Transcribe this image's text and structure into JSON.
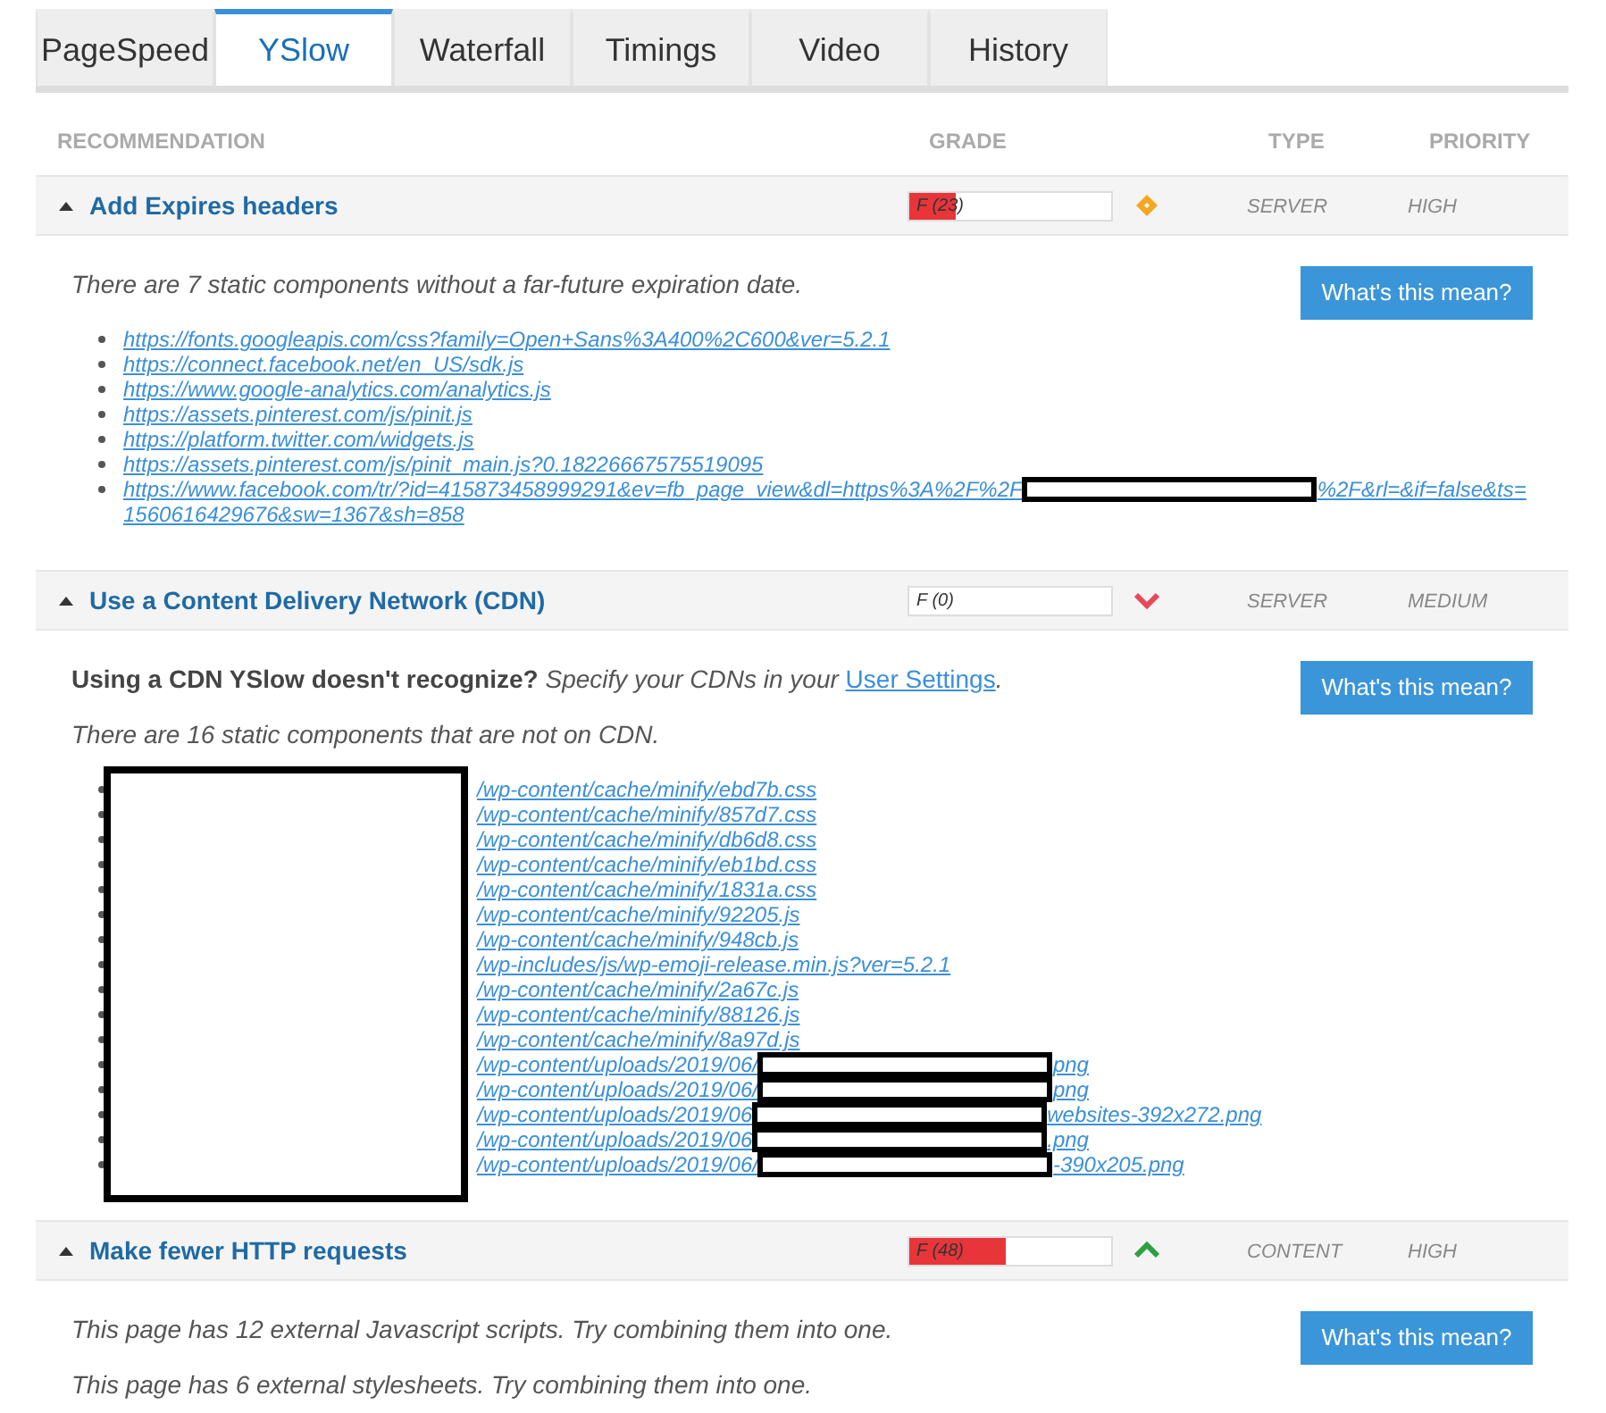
{
  "tabs": [
    {
      "label": "PageSpeed",
      "selected": false
    },
    {
      "label": "YSlow",
      "selected": true
    },
    {
      "label": "Waterfall",
      "selected": false
    },
    {
      "label": "Timings",
      "selected": false
    },
    {
      "label": "Video",
      "selected": false
    },
    {
      "label": "History",
      "selected": false
    }
  ],
  "columns": [
    "RECOMMENDATION",
    "GRADE",
    "TYPE",
    "PRIORITY"
  ],
  "rules": [
    {
      "title": "Add Expires headers",
      "expanded": true,
      "grade": "F (23)",
      "level": 0.23,
      "kind": "diamond",
      "type": "SERVER",
      "priority": "HIGH",
      "button": "What's this mean?",
      "paragraphs": [
        "There are 7 static components without a far-future expiration date."
      ],
      "links": [
        {
          "segments": [
            {
              "kind": "text",
              "text": "https://fonts.googleapis.com/css?family=Open+Sans%3A400%2C600&ver=5.2.1"
            }
          ]
        },
        {
          "segments": [
            {
              "kind": "text",
              "text": "https://connect.facebook.net/en_US/sdk.js"
            }
          ]
        },
        {
          "segments": [
            {
              "kind": "text",
              "text": "https://www.google-analytics.com/analytics.js"
            }
          ]
        },
        {
          "segments": [
            {
              "kind": "text",
              "text": "https://assets.pinterest.com/js/pinit.js"
            }
          ]
        },
        {
          "segments": [
            {
              "kind": "text",
              "text": "https://platform.twitter.com/widgets.js"
            }
          ]
        },
        {
          "segments": [
            {
              "kind": "text",
              "text": "https://assets.pinterest.com/js/pinit_main.js?0.18226667575519095"
            }
          ]
        },
        {
          "segments": [
            {
              "kind": "text",
              "text": "https://www.facebook.com/tr/?id=415873458999291&ev=fb_page_view&dl=https%3A%2F%2F"
            },
            {
              "kind": "redacted"
            },
            {
              "kind": "text",
              "text": "%2F&rl=&if=false&ts="
            },
            {
              "kind": "break"
            },
            {
              "kind": "text",
              "text": "1560616429676&sw=1367&sh=858"
            }
          ]
        }
      ]
    },
    {
      "title": "Use a Content Delivery Network (CDN)",
      "expanded": true,
      "grade": "F (0)",
      "level": 0,
      "kind": "down",
      "type": "SERVER",
      "priority": "MEDIUM",
      "button": "What's this mean?",
      "note": {
        "lead": "Using a CDN YSlow doesn't recognize?",
        "text": "Specify your CDNs in your",
        "link": "User Settings",
        "tail": "."
      },
      "paragraphs": [
        "There are 16 static components that are not on CDN."
      ],
      "redacted_prefix": true,
      "links": [
        {
          "segments": [
            {
              "kind": "text",
              "text": "/wp-content/cache/minify/ebd7b.css"
            }
          ]
        },
        {
          "segments": [
            {
              "kind": "text",
              "text": "/wp-content/cache/minify/857d7.css"
            }
          ]
        },
        {
          "segments": [
            {
              "kind": "text",
              "text": "/wp-content/cache/minify/db6d8.css"
            }
          ]
        },
        {
          "segments": [
            {
              "kind": "text",
              "text": "/wp-content/cache/minify/eb1bd.css"
            }
          ]
        },
        {
          "segments": [
            {
              "kind": "text",
              "text": "/wp-content/cache/minify/1831a.css"
            }
          ]
        },
        {
          "segments": [
            {
              "kind": "text",
              "text": "/wp-content/cache/minify/92205.js"
            }
          ]
        },
        {
          "segments": [
            {
              "kind": "text",
              "text": "/wp-content/cache/minify/948cb.js"
            }
          ]
        },
        {
          "segments": [
            {
              "kind": "text",
              "text": "/wp-includes/js/wp-emoji-release.min.js?ver=5.2.1"
            }
          ]
        },
        {
          "segments": [
            {
              "kind": "text",
              "text": "/wp-content/cache/minify/2a67c.js"
            }
          ]
        },
        {
          "segments": [
            {
              "kind": "text",
              "text": "/wp-content/cache/minify/88126.js"
            }
          ]
        },
        {
          "segments": [
            {
              "kind": "text",
              "text": "/wp-content/cache/minify/8a97d.js"
            }
          ]
        },
        {
          "segments": [
            {
              "kind": "text",
              "text": "/wp-content/uploads/2019/06/"
            },
            {
              "kind": "redacted"
            },
            {
              "kind": "text",
              "text": "png"
            }
          ]
        },
        {
          "segments": [
            {
              "kind": "text",
              "text": "/wp-content/uploads/2019/06/"
            },
            {
              "kind": "redacted"
            },
            {
              "kind": "text",
              "text": "png"
            }
          ]
        },
        {
          "segments": [
            {
              "kind": "text",
              "text": "/wp-content/uploads/2019/06"
            },
            {
              "kind": "redacted"
            },
            {
              "kind": "text",
              "text": "websites-392x272.png"
            }
          ]
        },
        {
          "segments": [
            {
              "kind": "text",
              "text": "/wp-content/uploads/2019/06"
            },
            {
              "kind": "redacted"
            },
            {
              "kind": "text",
              "text": ".png"
            }
          ]
        },
        {
          "segments": [
            {
              "kind": "text",
              "text": "/wp-content/uploads/2019/06/"
            },
            {
              "kind": "redacted"
            },
            {
              "kind": "text",
              "text": "-390x205.png"
            }
          ]
        }
      ]
    },
    {
      "title": "Make fewer HTTP requests",
      "expanded": true,
      "grade": "F (48)",
      "level": 0.48,
      "kind": "up",
      "type": "CONTENT",
      "priority": "HIGH",
      "button": "What's this mean?",
      "paragraphs": [
        "This page has 12 external Javascript scripts. Try combining them into one.",
        "This page has 6 external stylesheets. Try combining them into one."
      ]
    }
  ]
}
